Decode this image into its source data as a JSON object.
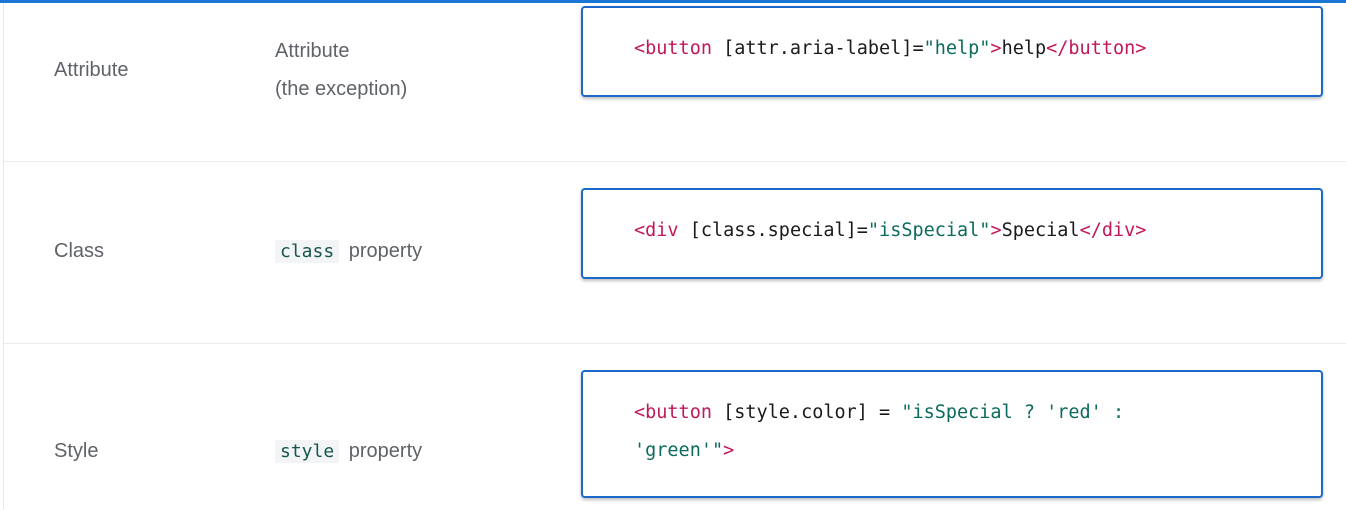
{
  "rows": [
    {
      "label": "Attribute",
      "description": [
        "Attribute",
        "(the exception)"
      ],
      "code_lines": [
        [
          {
            "t": "<button",
            "k": "tag"
          },
          {
            "t": " [attr.aria-label]=",
            "k": "attr"
          },
          {
            "t": "\"help\"",
            "k": "str"
          },
          {
            "t": ">",
            "k": "tag"
          },
          {
            "t": "help",
            "k": "text"
          },
          {
            "t": "</button>",
            "k": "tag"
          }
        ]
      ]
    },
    {
      "label": "Class",
      "description_code": "class",
      "description_text": "property",
      "code_lines": [
        [
          {
            "t": "<div",
            "k": "tag"
          },
          {
            "t": " [class.special]=",
            "k": "attr"
          },
          {
            "t": "\"isSpecial\"",
            "k": "str"
          },
          {
            "t": ">",
            "k": "tag"
          },
          {
            "t": "Special",
            "k": "text"
          },
          {
            "t": "</div>",
            "k": "tag"
          }
        ]
      ]
    },
    {
      "label": "Style",
      "description_code": "style",
      "description_text": "property",
      "code_lines": [
        [
          {
            "t": "<button",
            "k": "tag"
          },
          {
            "t": " [style.color] = ",
            "k": "attr"
          },
          {
            "t": "\"isSpecial ? 'red' :",
            "k": "str"
          }
        ],
        [
          {
            "t": "'green'\"",
            "k": "str"
          },
          {
            "t": ">",
            "k": "tag"
          }
        ]
      ]
    }
  ],
  "colors": {
    "accent": "#1b6ac9",
    "tag": "#c2185b",
    "string": "#0b6b5c",
    "label": "#5f6368"
  }
}
